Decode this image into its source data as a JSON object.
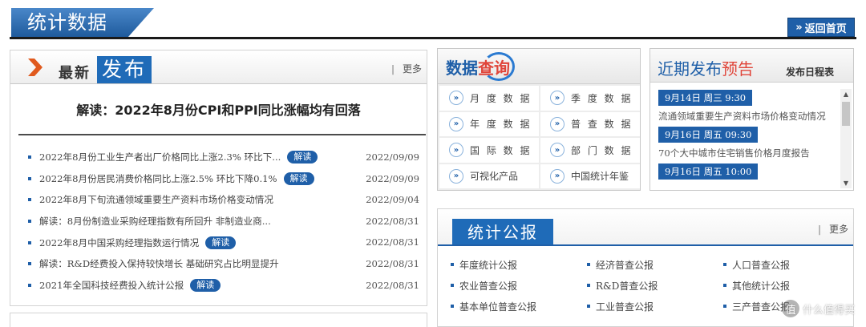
{
  "header": {
    "title": "统计数据",
    "back_home": "返回首页",
    "back_home_arrow": "»"
  },
  "latest": {
    "title_small": "最新",
    "title_big": "发布",
    "more_bar": "|",
    "more": "更多",
    "headline": "解读：2022年8月份CPI和PPI同比涨幅均有回落",
    "items": [
      {
        "text": "2022年8月份工业生产者出厂价格同比上涨2.3% 环比下...",
        "badge": "解读",
        "date": "2022/09/09"
      },
      {
        "text": "2022年8月份居民消费价格同比上涨2.5% 环比下降0.1%",
        "badge": "解读",
        "date": "2022/09/09"
      },
      {
        "text": "2022年8月下旬流通领域重要生产资料市场价格变动情况",
        "badge": "",
        "date": "2022/09/04"
      },
      {
        "text": "解读：8月份制造业采购经理指数有所回升 非制造业商...",
        "badge": "",
        "date": "2022/08/31"
      },
      {
        "text": "2022年8月中国采购经理指数运行情况",
        "badge": "解读",
        "date": "2022/08/31"
      },
      {
        "text": "解读：R&D经费投入保持较快增长 基础研究占比明显提升",
        "badge": "",
        "date": "2022/08/31"
      },
      {
        "text": "2021年全国科技经费投入统计公报",
        "badge": "解读",
        "date": "2022/08/31"
      }
    ]
  },
  "query": {
    "title_part1": "数据",
    "title_part2": "查询",
    "arrow_glyph": "»",
    "cells": [
      "月 度 数 据",
      "季 度 数 据",
      "年 度 数 据",
      "普 查 数 据",
      "国 际 数 据",
      "部 门 数 据",
      "可视化产品",
      "中国统计年鉴"
    ]
  },
  "upcoming": {
    "title_part1": "近期发布",
    "title_part2": "预告",
    "schedule": "发布日程表",
    "items": [
      {
        "date": "9月14日 周三 9:30",
        "text": "流通领域重要生产资料市场价格变动情况"
      },
      {
        "date": "9月16日 周五 09:30",
        "text": "70个大中城市住宅销售价格月度报告"
      },
      {
        "date": "9月16日 周五 10:00",
        "text": ""
      }
    ],
    "scroll_up": "▲",
    "scroll_down": "▼"
  },
  "bulletin": {
    "title": "统计公报",
    "more_bar": "|",
    "more": "更多",
    "items": [
      "年度统计公报",
      "经济普查公报",
      "人口普查公报",
      "农业普查公报",
      "R&D普查公报",
      "其他统计公报",
      "基本单位普查公报",
      "工业普查公报",
      "三产普查公报"
    ]
  },
  "watermark": {
    "glyph": "值",
    "text": "什么值得买"
  },
  "colors": {
    "brand_blue": "#1f5fa8",
    "accent_red": "#e0453a",
    "arrow_orange": "#e05a1e"
  }
}
